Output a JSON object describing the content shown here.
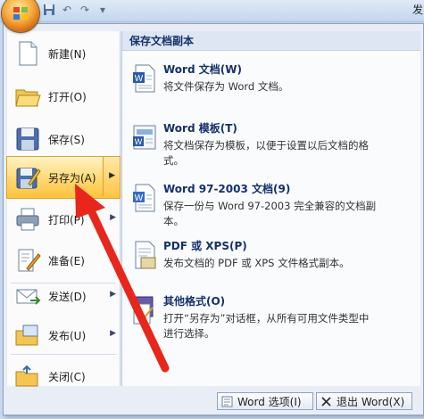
{
  "qat": {
    "partial_tab": "发"
  },
  "menu": {
    "items": [
      {
        "label": "新建(N)",
        "icon": "new-document-icon",
        "submenu": false
      },
      {
        "label": "打开(O)",
        "icon": "open-folder-icon",
        "submenu": false
      },
      {
        "label": "保存(S)",
        "icon": "save-disk-icon",
        "submenu": false
      },
      {
        "label": "另存为(A)",
        "icon": "save-as-icon",
        "submenu": true,
        "selected": true
      },
      {
        "label": "打印(P)",
        "icon": "printer-icon",
        "submenu": true
      },
      {
        "label": "准备(E)",
        "icon": "prepare-icon",
        "submenu": true
      },
      {
        "label": "发送(D)",
        "icon": "send-icon",
        "submenu": true
      },
      {
        "label": "发布(U)",
        "icon": "publish-icon",
        "submenu": true
      },
      {
        "label": "关闭(C)",
        "icon": "close-document-icon",
        "submenu": false
      }
    ]
  },
  "saveas_panel": {
    "title": "保存文档副本",
    "options": [
      {
        "title": "Word 文档(W)",
        "desc": "将文件保存为 Word 文档。",
        "icon": "word-document-icon"
      },
      {
        "title": "Word 模板(T)",
        "desc": "将文档保存为模板，以便于设置以后文档的格式。",
        "icon": "word-template-icon"
      },
      {
        "title": "Word 97-2003 文档(9)",
        "desc": "保存一份与 Word 97-2003 完全兼容的文档副本。",
        "icon": "word-97-2003-icon"
      },
      {
        "title": "PDF 或 XPS(P)",
        "desc": "发布文档的 PDF 或 XPS 文件格式副本。",
        "icon": "pdf-xps-icon"
      },
      {
        "title": "其他格式(O)",
        "desc": "打开“另存为”对话框，从所有可用文件类型中进行选择。",
        "icon": "other-formats-icon"
      }
    ]
  },
  "bottom": {
    "options_label": "Word 选项(I)",
    "exit_label": "退出 Word(X)"
  },
  "colors": {
    "annotation_arrow": "#e8261c",
    "selection": "#ffd56a"
  }
}
